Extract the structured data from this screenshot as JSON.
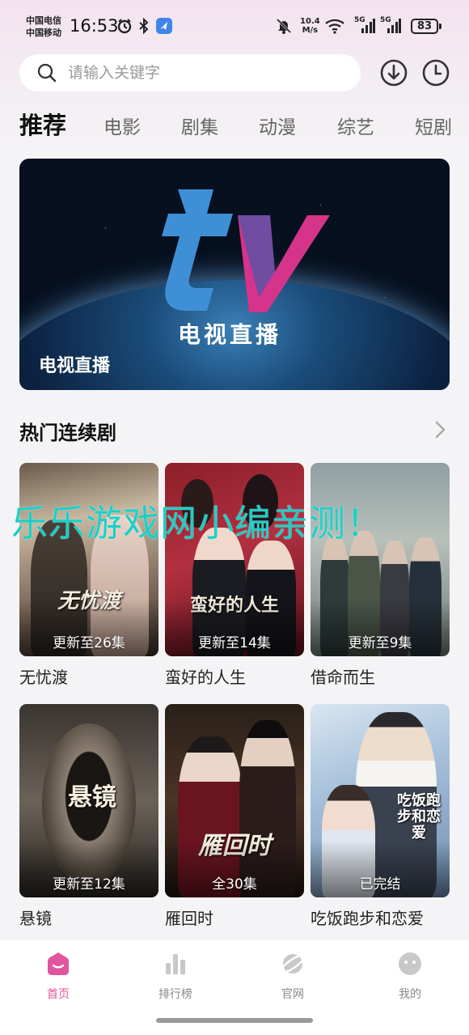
{
  "status_bar": {
    "carrier_1": "中国电信",
    "carrier_2": "中国移动",
    "time": "16:53",
    "net_speed_value": "10.4",
    "net_speed_unit": "M/s",
    "signal_1": "5G",
    "signal_2": "5G",
    "battery": "83"
  },
  "search": {
    "placeholder": "请输入关键字"
  },
  "tabs": [
    {
      "label": "推荐",
      "active": true
    },
    {
      "label": "电影"
    },
    {
      "label": "剧集"
    },
    {
      "label": "动漫"
    },
    {
      "label": "综艺"
    },
    {
      "label": "短剧"
    }
  ],
  "banner": {
    "logo_text": "电视直播",
    "caption": "电视直播"
  },
  "section": {
    "title": "热门连续剧"
  },
  "shows": [
    {
      "name": "无忧渡",
      "update": "更新至26集",
      "poster_title": "无忧渡"
    },
    {
      "name": "蛮好的人生",
      "update": "更新至14集",
      "poster_title": "蛮好的人生"
    },
    {
      "name": "借命而生",
      "update": "更新至9集",
      "poster_title": ""
    },
    {
      "name": "悬镜",
      "update": "更新至12集",
      "poster_title": "悬镜"
    },
    {
      "name": "雁回时",
      "update": "全30集",
      "poster_title": "雁回时"
    },
    {
      "name": "吃饭跑步和恋爱",
      "update": "已完结",
      "poster_title": "吃饭跑步和恋爱"
    }
  ],
  "watermark": "乐乐游戏网小编亲测！",
  "bottom_nav": [
    {
      "label": "首页",
      "icon": "home-icon",
      "active": true
    },
    {
      "label": "排行榜",
      "icon": "bar-chart-icon"
    },
    {
      "label": "官网",
      "icon": "planet-icon"
    },
    {
      "label": "我的",
      "icon": "face-icon"
    }
  ],
  "colors": {
    "accent": "#e0559d",
    "watermark": "#19d0c8",
    "tv_blue": "#3f8fd6",
    "tv_pink": "#d6338a"
  }
}
